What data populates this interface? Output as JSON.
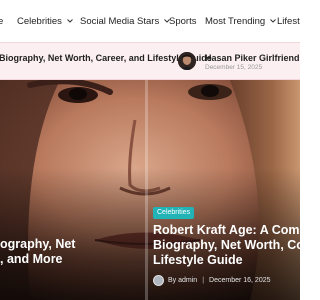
{
  "nav": {
    "items": [
      {
        "label": "e",
        "has_dropdown": false
      },
      {
        "label": "Celebrities",
        "has_dropdown": true
      },
      {
        "label": "Social Media Stars",
        "has_dropdown": true
      },
      {
        "label": "Sports",
        "has_dropdown": false
      },
      {
        "label": "Most Trending",
        "has_dropdown": true
      },
      {
        "label": "Lifest",
        "has_dropdown": false
      }
    ]
  },
  "ticker": {
    "items": [
      {
        "title": "Biography, Net Worth, Career, and Lifestyle Guide",
        "date": ""
      },
      {
        "title": "Hasan Piker Girlfriend, Age, H",
        "date": "December 15, 2025"
      }
    ]
  },
  "hero": {
    "left_post": {
      "title": "ography, Net\n, and More"
    },
    "right_post": {
      "category": "Celebrities",
      "title_lines": [
        "Robert Kraft Age: A Comp",
        "Biography, Net Worth, Co",
        "Lifestyle Guide"
      ],
      "author": "By admin",
      "date": "December 16, 2025"
    }
  },
  "colors": {
    "accent": "#e53964",
    "badge": "#22b3b6",
    "ticker_bg": "#fbeff1"
  }
}
